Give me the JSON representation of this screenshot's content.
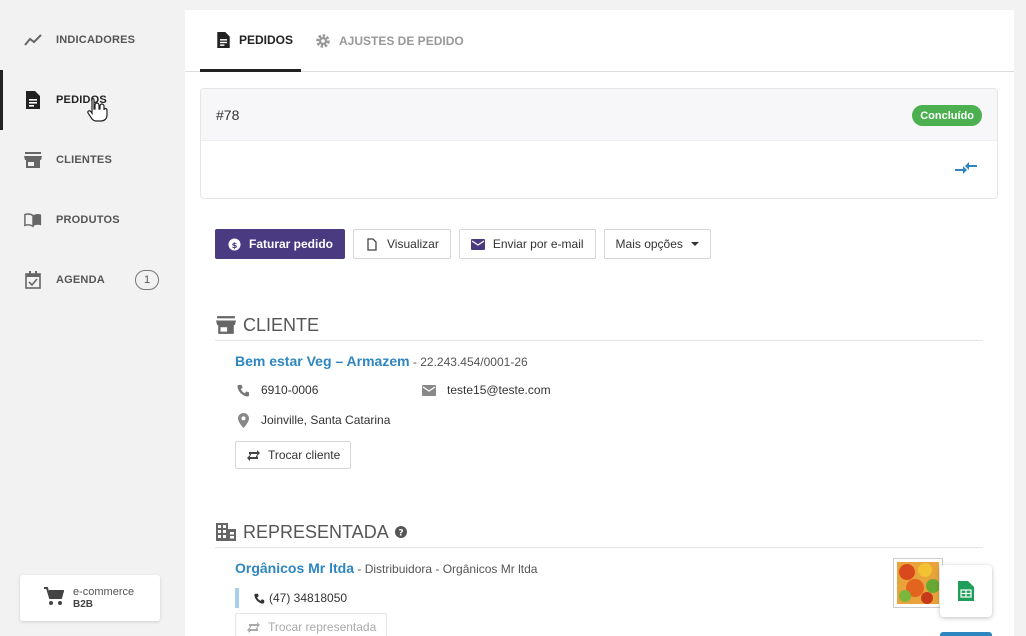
{
  "sidebar": {
    "items": [
      {
        "label": "INDICADORES",
        "icon": "trend-line-icon"
      },
      {
        "label": "PEDIDOS",
        "icon": "document-icon",
        "active": true
      },
      {
        "label": "CLIENTES",
        "icon": "store-icon"
      },
      {
        "label": "PRODUTOS",
        "icon": "book-icon"
      },
      {
        "label": "AGENDA",
        "icon": "calendar-check-icon",
        "badge": "1"
      }
    ],
    "ecommerce": {
      "line1": "e-commerce",
      "line2": "B2B"
    }
  },
  "tabs": [
    {
      "label": "PEDIDOS",
      "icon": "document-icon",
      "active": true
    },
    {
      "label": "AJUSTES DE PEDIDO",
      "icon": "gear-icon"
    }
  ],
  "order": {
    "number": "#78",
    "status": "Concluído",
    "status_color": "#4caf50"
  },
  "actions": {
    "invoice": "Faturar pedido",
    "view": "Visualizar",
    "email": "Enviar por e-mail",
    "more": "Mais opções"
  },
  "client": {
    "section_title": "CLIENTE",
    "name": "Bem estar Veg – Armazem",
    "document": " - 22.243.454/0001-26",
    "phone": "6910-0006",
    "email": "teste15@teste.com",
    "location": "Joinville, Santa Catarina",
    "change_label": "Trocar cliente"
  },
  "representative": {
    "section_title": "REPRESENTADA",
    "name": "Orgânicos Mr ltda",
    "description": " - Distribuidora - Orgânicos Mr ltda",
    "phone": "(47) 34818050",
    "change_label": "Trocar representada"
  },
  "colors": {
    "primary": "#4a3a82",
    "link": "#2e86c1",
    "success": "#4caf50"
  }
}
